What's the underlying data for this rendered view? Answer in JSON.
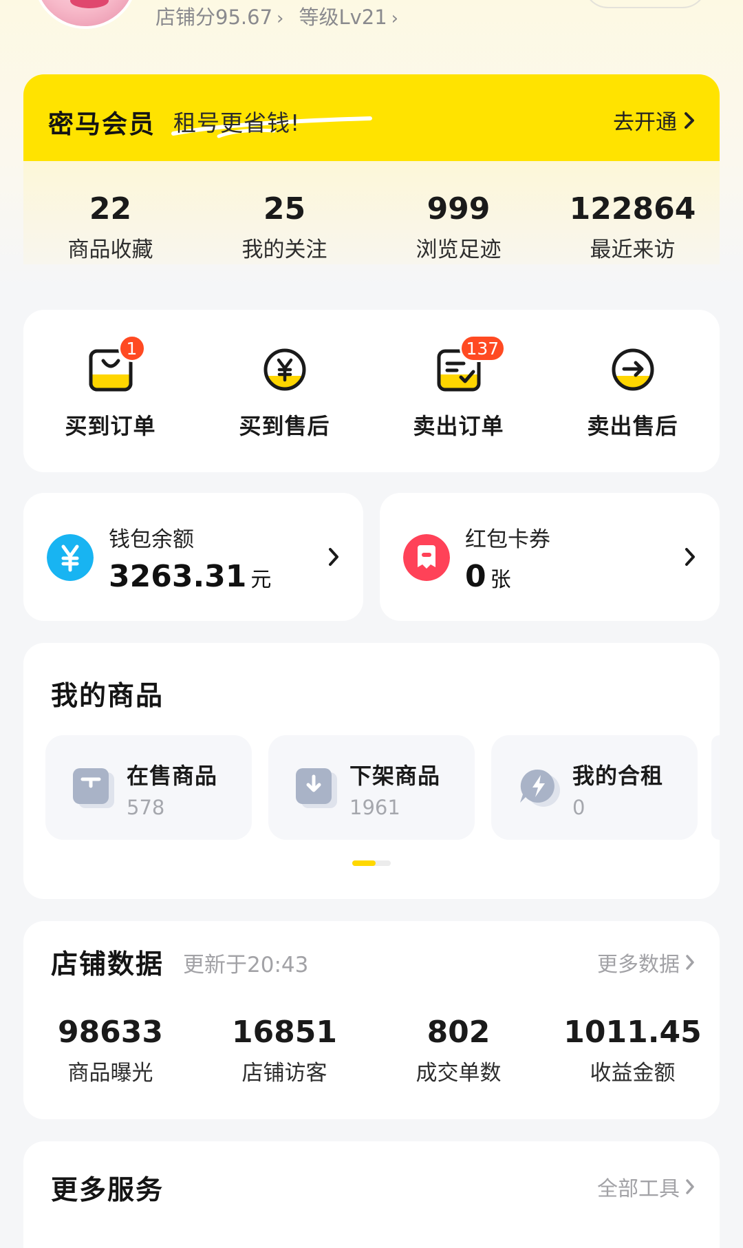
{
  "header": {
    "shop_score": "店铺分95.67",
    "level": "等级Lv21"
  },
  "member": {
    "title": "密马会员",
    "slogan": "租号更省钱!",
    "cta": "去开通",
    "colors": {
      "banner": "#ffe300"
    }
  },
  "profile_stats": [
    {
      "value": "22",
      "label": "商品收藏"
    },
    {
      "value": "25",
      "label": "我的关注"
    },
    {
      "value": "999",
      "label": "浏览足迹"
    },
    {
      "value": "122864",
      "label": "最近来访"
    }
  ],
  "orders": [
    {
      "label": "买到订单",
      "icon": "shopping-bag-icon",
      "badge": "1"
    },
    {
      "label": "买到售后",
      "icon": "yuan-coin-icon",
      "badge": ""
    },
    {
      "label": "卖出订单",
      "icon": "order-note-icon",
      "badge": "137"
    },
    {
      "label": "卖出售后",
      "icon": "arrow-right-circle-icon",
      "badge": ""
    }
  ],
  "wallet": {
    "label": "钱包余额",
    "value": "3263.31",
    "unit": "元",
    "icon": "yuan-wallet-icon",
    "color": "#18b4f2"
  },
  "coupon": {
    "label": "红包卡券",
    "value": "0",
    "unit": "张",
    "icon": "red-packet-icon",
    "color": "#ff4258"
  },
  "my_goods": {
    "title": "我的商品",
    "items": [
      {
        "name": "在售商品",
        "count": "578",
        "icon": "shop-box-icon"
      },
      {
        "name": "下架商品",
        "count": "1961",
        "icon": "download-box-icon"
      },
      {
        "name": "我的合租",
        "count": "0",
        "icon": "lightning-chat-icon"
      }
    ],
    "page_index": 1,
    "page_count": 2
  },
  "shop_data": {
    "title": "店铺数据",
    "updated": "更新于20:43",
    "more": "更多数据",
    "stats": [
      {
        "value": "98633",
        "label": "商品曝光"
      },
      {
        "value": "16851",
        "label": "店铺访客"
      },
      {
        "value": "802",
        "label": "成交单数"
      },
      {
        "value": "1011.45",
        "label": "收益金额"
      }
    ]
  },
  "services": {
    "title": "更多服务",
    "more": "全部工具"
  }
}
